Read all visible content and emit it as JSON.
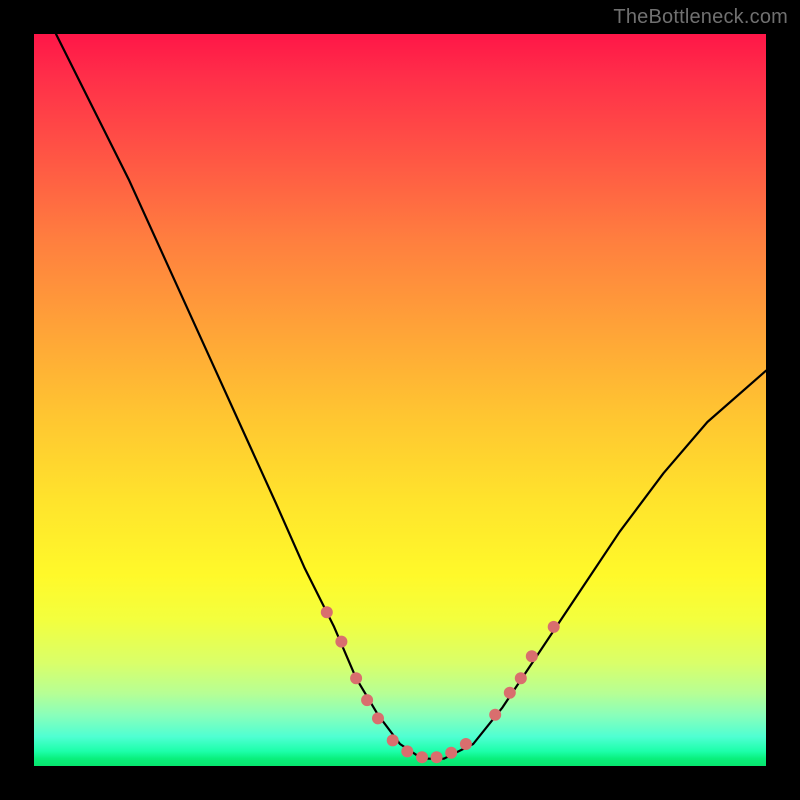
{
  "watermark": "TheBottleneck.com",
  "chart_data": {
    "type": "line",
    "title": "",
    "xlabel": "",
    "ylabel": "",
    "xlim": [
      0,
      100
    ],
    "ylim": [
      0,
      100
    ],
    "grid": false,
    "legend": false,
    "series": [
      {
        "name": "bottleneck-curve",
        "color": "#000000",
        "x": [
          3,
          8,
          13,
          18,
          23,
          28,
          33,
          37,
          41,
          44,
          47,
          50,
          53,
          56,
          60,
          64,
          68,
          74,
          80,
          86,
          92,
          100
        ],
        "y": [
          100,
          90,
          80,
          69,
          58,
          47,
          36,
          27,
          19,
          12,
          7,
          3,
          1,
          1,
          3,
          8,
          14,
          23,
          32,
          40,
          47,
          54
        ]
      }
    ],
    "markers": {
      "name": "highlight-dots",
      "color": "#d96e6e",
      "radius": 6,
      "points": [
        {
          "x": 40,
          "y": 21
        },
        {
          "x": 42,
          "y": 17
        },
        {
          "x": 44,
          "y": 12
        },
        {
          "x": 45.5,
          "y": 9
        },
        {
          "x": 47,
          "y": 6.5
        },
        {
          "x": 49,
          "y": 3.5
        },
        {
          "x": 51,
          "y": 2
        },
        {
          "x": 53,
          "y": 1.2
        },
        {
          "x": 55,
          "y": 1.2
        },
        {
          "x": 57,
          "y": 1.8
        },
        {
          "x": 59,
          "y": 3
        },
        {
          "x": 63,
          "y": 7
        },
        {
          "x": 65,
          "y": 10
        },
        {
          "x": 66.5,
          "y": 12
        },
        {
          "x": 68,
          "y": 15
        },
        {
          "x": 71,
          "y": 19
        }
      ]
    },
    "background_gradient": {
      "orientation": "vertical",
      "stops": [
        {
          "pos": 0.0,
          "color": "#ff1648"
        },
        {
          "pos": 0.28,
          "color": "#ff7e3f"
        },
        {
          "pos": 0.64,
          "color": "#ffe42c"
        },
        {
          "pos": 0.86,
          "color": "#d9ff6a"
        },
        {
          "pos": 1.0,
          "color": "#07e56e"
        }
      ]
    }
  }
}
